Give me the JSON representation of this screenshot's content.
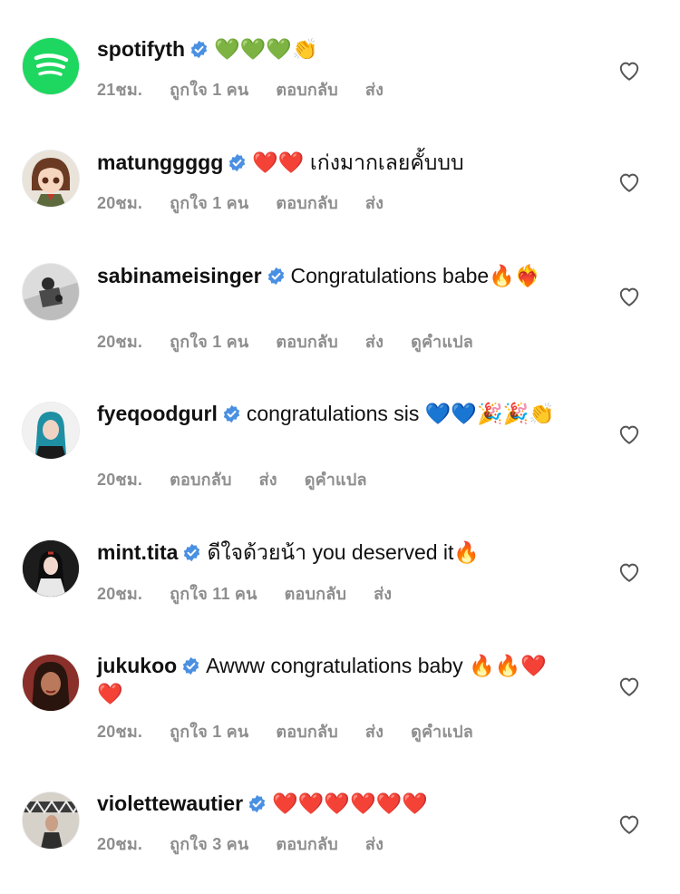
{
  "comments": [
    {
      "username": "spotifyth",
      "text": "💚💚💚👏",
      "time": "21ชม.",
      "likes": "ถูกใจ 1 คน",
      "reply": "ตอบกลับ",
      "send": "ส่ง",
      "translate": ""
    },
    {
      "username": "matunggggg",
      "text": "❤️❤️ เก่งมากเลยคั้บบบ",
      "time": "20ชม.",
      "likes": "ถูกใจ 1 คน",
      "reply": "ตอบกลับ",
      "send": "ส่ง",
      "translate": ""
    },
    {
      "username": "sabinameisinger",
      "text": "Congratulations babe🔥❤️‍🔥",
      "time": "20ชม.",
      "likes": "ถูกใจ 1 คน",
      "reply": "ตอบกลับ",
      "send": "ส่ง",
      "translate": "ดูคำแปล"
    },
    {
      "username": "fyeqoodgurl",
      "text": "congratulations sis 💙💙🎉🎉👏",
      "time": "20ชม.",
      "likes": "",
      "reply": "ตอบกลับ",
      "send": "ส่ง",
      "translate": "ดูคำแปล"
    },
    {
      "username": "mint.tita",
      "text": "ดีใจด้วยน้า you deserved it🔥",
      "time": "20ชม.",
      "likes": "ถูกใจ 11 คน",
      "reply": "ตอบกลับ",
      "send": "ส่ง",
      "translate": ""
    },
    {
      "username": "jukukoo",
      "text": "Awww congratulations baby 🔥🔥❤️❤️",
      "time": "20ชม.",
      "likes": "ถูกใจ 1 คน",
      "reply": "ตอบกลับ",
      "send": "ส่ง",
      "translate": "ดูคำแปล"
    },
    {
      "username": "violettewautier",
      "text": "❤️❤️❤️❤️❤️❤️",
      "time": "20ชม.",
      "likes": "ถูกใจ 3 คน",
      "reply": "ตอบกลับ",
      "send": "ส่ง",
      "translate": ""
    }
  ],
  "colors": {
    "verified": "#4a90e2",
    "meta_text": "#8e8e8e",
    "spotify_green": "#1ed760"
  },
  "icons": {
    "like": "heart-outline-icon",
    "verified": "verified-badge-icon"
  }
}
